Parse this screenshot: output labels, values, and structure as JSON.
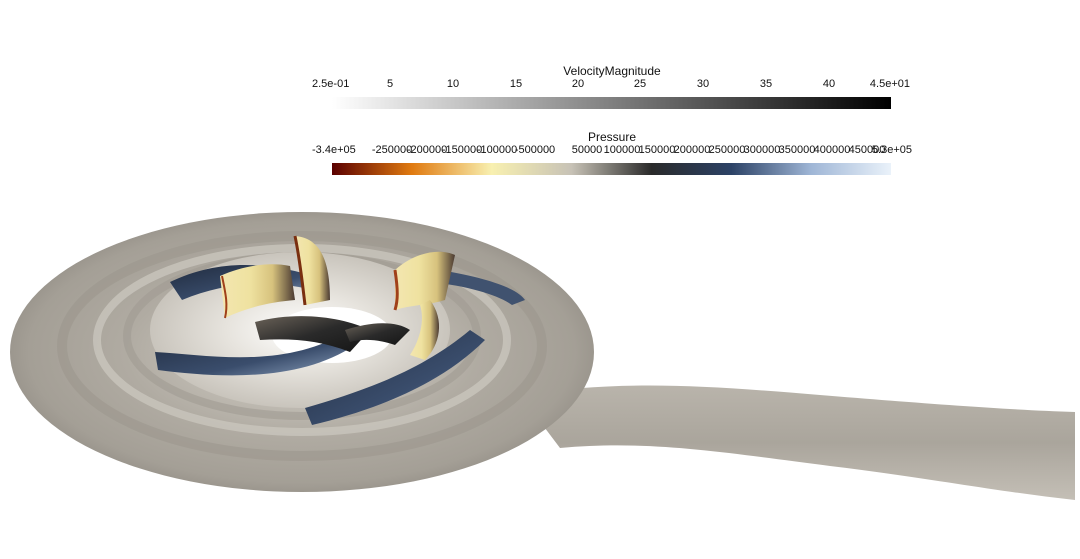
{
  "velocity_bar": {
    "title": "VelocityMagnitude",
    "labels": [
      "2.5e-01",
      "5",
      "10",
      "15",
      "20",
      "25",
      "30",
      "35",
      "40",
      "4.5e+01"
    ],
    "colors": [
      "#ffffff",
      "#000000"
    ]
  },
  "pressure_bar": {
    "title": "Pressure",
    "labels": [
      "-3.4e+05",
      "-250000",
      "-200000",
      "-150000",
      "-100000",
      "-50000",
      "0",
      "50000",
      "100000",
      "150000",
      "200000",
      "250000",
      "300000",
      "350000",
      "400000",
      "450000",
      "5.3e+05"
    ],
    "colors": [
      "#5a0000",
      "#e07a10",
      "#f8f0b0",
      "#c7c2b6",
      "#2a2a2a",
      "#2c4266",
      "#9fb6d6",
      "#eaf2fa"
    ]
  },
  "colors": {
    "casing": "#b3aea5",
    "casing_dark": "#8d8880",
    "blade_dark": "#2c3b55",
    "blade_light": "#8ea3bf",
    "hub": "#dcd9d2"
  }
}
